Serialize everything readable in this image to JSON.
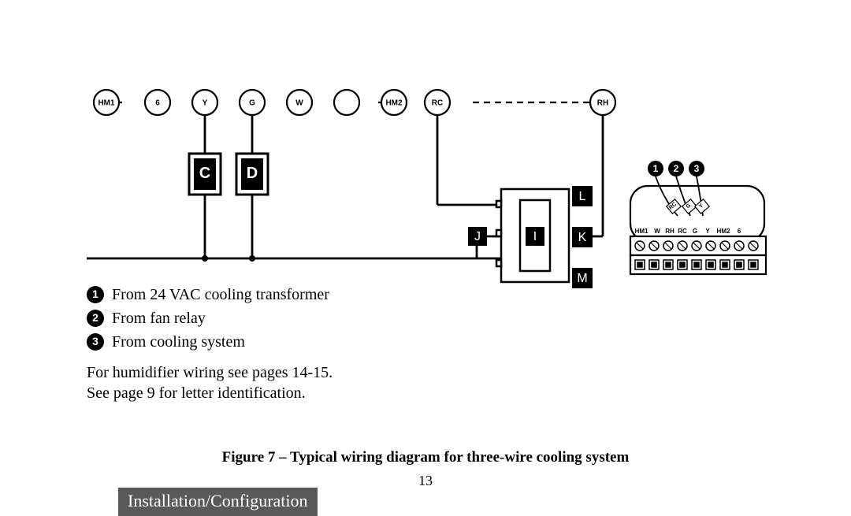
{
  "diagram": {
    "top_terminals": [
      "HM1",
      "6",
      "Y",
      "G",
      "W",
      "",
      "HM2",
      "RC",
      "RH"
    ],
    "boxes": {
      "C": "C",
      "D": "D",
      "L": "L",
      "I": "I",
      "J": "J",
      "K": "K",
      "M": "M"
    },
    "callouts": [
      "1",
      "2",
      "3"
    ],
    "strip_labels": [
      "HM1",
      "W",
      "RH",
      "RC",
      "G",
      "Y",
      "HM2",
      "6"
    ],
    "wire_tags": [
      "RC",
      "G",
      "Y"
    ]
  },
  "legend": [
    {
      "num": "1",
      "text": "From 24 VAC cooling transformer"
    },
    {
      "num": "2",
      "text": "From fan relay"
    },
    {
      "num": "3",
      "text": "From cooling system"
    }
  ],
  "notes": {
    "line1": "For humidifier wiring see pages 14-15.",
    "line2": "See page 9 for letter identification."
  },
  "caption": "Figure 7 – Typical wiring diagram for three-wire cooling system",
  "page_number": "13",
  "section": "Installation/Configuration"
}
